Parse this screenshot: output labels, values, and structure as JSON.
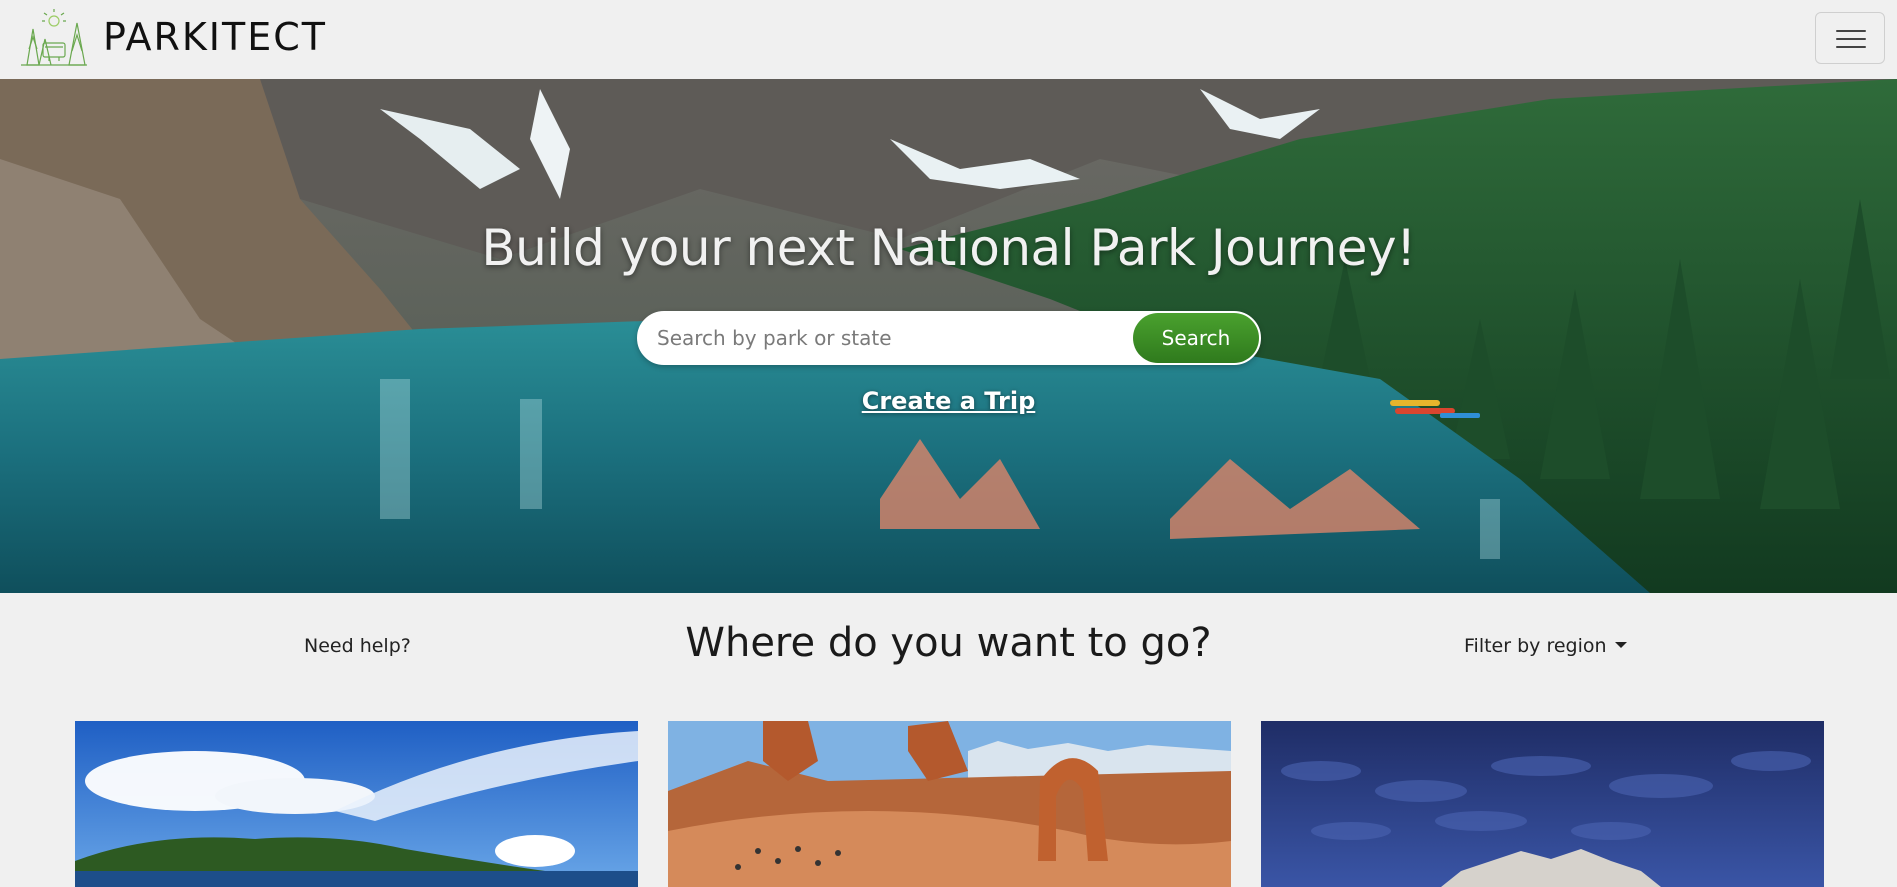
{
  "navbar": {
    "brand": "PARKITECT",
    "menu_toggle": "menu"
  },
  "hero": {
    "title": "Build your next National Park Journey!",
    "search_placeholder": "Search by park or state",
    "search_button": "Search",
    "create_trip": "Create a Trip"
  },
  "section": {
    "need_help": "Need help?",
    "title": "Where do you want to go?",
    "filter_label": "Filter by region"
  },
  "cards": [
    {
      "scene": "coastal-forest-sky"
    },
    {
      "scene": "desert-arch"
    },
    {
      "scene": "stormy-badlands"
    }
  ],
  "colors": {
    "accent": "#3d8f27",
    "background": "#f0f0f0"
  }
}
